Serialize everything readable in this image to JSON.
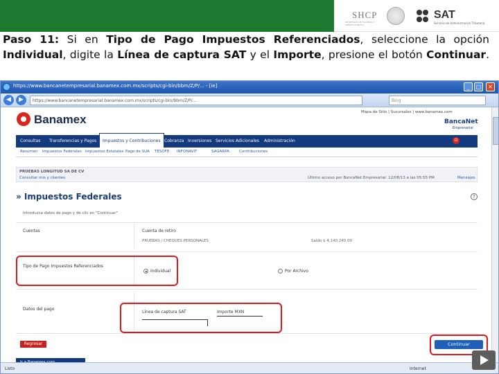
{
  "header": {
    "shcp": "SHCP",
    "shcp_sub": "SECRETARÍA DE HACIENDA Y CRÉDITO PÚBLICO",
    "sat": "SAT",
    "sat_sub": "Servicio de Administración Tributaria",
    "green": "#1f7a31"
  },
  "instruction": {
    "step": "Paso 11:",
    "t1": " Si en ",
    "b1": "Tipo de Pago Impuestos Referenciados",
    "t2": ", seleccione la opción ",
    "b2": "Individual",
    "t3": ", digite la ",
    "b3": "Línea de captura SAT",
    "t4": " y el ",
    "b4": "Importe",
    "t5": ", presione el botón ",
    "b5": "Continuar",
    "t6": "."
  },
  "browser": {
    "title": "https://www.bancanetempresarial.banamex.com.mx/scripts/cgi-bin/bbm/Z/P/... - [ie]",
    "url": "https://www.bancanetempresarial.banamex.com.mx/scripts/cgi-bin/bbm/Z/P/...",
    "search_placeholder": "Bing",
    "status_left": "Listo",
    "status_right": "Internet",
    "min": "_",
    "max": "□",
    "close": "✕",
    "back": "◀",
    "fwd": "▶"
  },
  "bank": {
    "name": "Banamex",
    "toplinks": "Mapa de Sitio | Sucursales | www.banamex.com",
    "bancanet": "BancaNet",
    "bancanet_sub": "Empresarial",
    "menu": [
      "Consultas",
      "Transferencias y Pagos",
      "Impuestos y Contribuciones",
      "Cobranza",
      "Inversiones",
      "Servicios Adicionales",
      "Administración"
    ],
    "salir": "Salir",
    "submenu": [
      "Resumen",
      "Impuestos Federales",
      "Impuestos Estatales",
      "Pago de SUA",
      "TESOFE",
      "INFONAVIT",
      "SAGARPA",
      "Contribuciones"
    ],
    "company": "PRUEBAS LONGITUD SA DE CV",
    "change_user": "Consultar mis y clientes",
    "last_access": "Último acceso por BancaNet Empresarial: 12/08/13 a las 05:55 PM",
    "mensajes": "Mensajes",
    "heading": "» Impuestos Federales",
    "help": "?",
    "hint": "Introduzca datos de pago y de clic en \"Continuar\"",
    "cuentas_label": "Cuentas",
    "cuenta_cargo_label": "Cuenta de retiro",
    "cuenta_value": "PRUEBAS / CHEQUES PERSONALES",
    "saldo_value": "Saldo $ 4,140,240.00",
    "tipo_pago_label": "Tipo de Pago Impuestos Referenciados",
    "opt_individual": "Individual",
    "opt_archivo": "Por Archivo",
    "datos_label": "Datos del pago",
    "linea_label": "Línea de captura SAT",
    "importe_label": "Importe MXN",
    "regresar": "Regresar",
    "continuar": "Continuar",
    "bottom_nav": "Ir a Banamex.com"
  },
  "colors": {
    "highlight": "#e0161b",
    "bank_blue": "#133a7e"
  }
}
